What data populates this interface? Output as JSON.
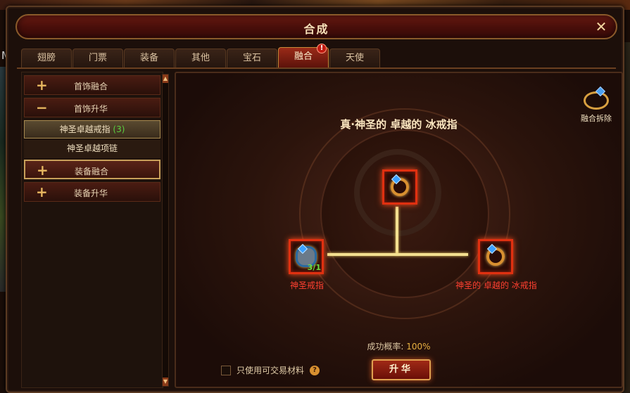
{
  "window": {
    "title": "合成",
    "close_label": "✕"
  },
  "side_letter": "M",
  "tabs": [
    {
      "label": "翅膀"
    },
    {
      "label": "门票"
    },
    {
      "label": "装备"
    },
    {
      "label": "其他"
    },
    {
      "label": "宝石"
    },
    {
      "label": "融合",
      "active": true,
      "badge": "!"
    },
    {
      "label": "天使"
    }
  ],
  "sidebar": {
    "items": [
      {
        "sign": "+",
        "label": "首饰融合"
      },
      {
        "sign": "−",
        "label": "首饰升华"
      },
      {
        "label": "神圣卓越戒指",
        "count": "(3)"
      },
      {
        "label": "神圣卓越项链"
      },
      {
        "sign": "+",
        "label": "装备融合"
      },
      {
        "sign": "+",
        "label": "装备升华"
      }
    ]
  },
  "main": {
    "target_title": "真·神圣的 卓越的 冰戒指",
    "disassemble_label": "融合拆除",
    "left_material": {
      "name": "神圣戒指",
      "qty": "3/1"
    },
    "right_material": {
      "name": "神圣的 卓越的 冰戒指"
    },
    "rate_label": "成功概率:",
    "rate_value": "100%",
    "tradable_label": "只使用可交易材料",
    "help": "?",
    "upgrade_label": "升华"
  },
  "colors": {
    "accent": "#e03010",
    "gold": "#e8b040",
    "count_green": "#5ad040"
  }
}
